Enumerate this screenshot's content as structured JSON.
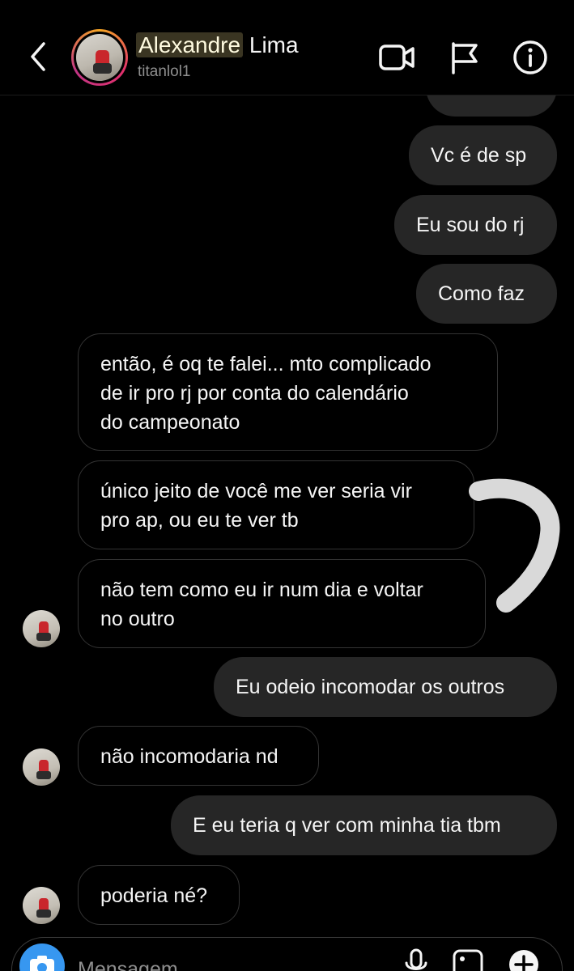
{
  "header": {
    "first_name": "Alexandre",
    "last_name": "Lima",
    "username": "titanlol1",
    "icons": [
      "back-icon",
      "video-call-icon",
      "flag-icon",
      "info-icon"
    ]
  },
  "messages": [
    {
      "direction": "sent",
      "text": ""
    },
    {
      "direction": "sent",
      "text": "Vc é de sp"
    },
    {
      "direction": "sent",
      "text": "Eu sou do rj"
    },
    {
      "direction": "sent",
      "text": "Como faz"
    },
    {
      "direction": "received",
      "lines": [
        "então, é oq te falei... mto complicado",
        "de ir pro rj por conta do calendário",
        "do campeonato"
      ]
    },
    {
      "direction": "received",
      "lines": [
        "único jeito de você me ver seria vir",
        "pro ap, ou eu te ver tb"
      ]
    },
    {
      "direction": "received",
      "lines": [
        "não tem como eu ir num dia e voltar",
        "no outro"
      ]
    },
    {
      "direction": "sent",
      "text": "Eu odeio incomodar os outros"
    },
    {
      "direction": "received",
      "lines": [
        "não incomodaria nd"
      ]
    },
    {
      "direction": "sent",
      "text": "E eu teria q ver com minha tia tbm"
    },
    {
      "direction": "received",
      "lines": [
        "poderia né?"
      ]
    }
  ],
  "composer": {
    "placeholder": "Mensagem",
    "icons": [
      "camera-icon",
      "microphone-icon",
      "gallery-icon",
      "plus-icon"
    ]
  },
  "colors": {
    "background": "#000000",
    "sent_bubble": "#262626",
    "received_border": "#333333",
    "camera_button": "#3797f0",
    "name_highlight": "#3a3522",
    "scribble": "#d9d9d9"
  }
}
